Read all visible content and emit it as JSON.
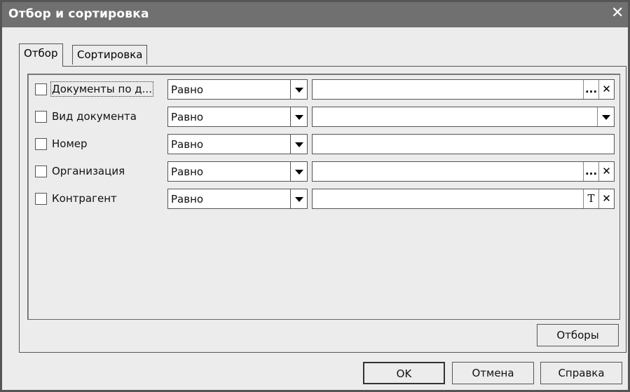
{
  "window": {
    "title": "Отбор и сортировка",
    "close_label": "✕"
  },
  "tabs": [
    {
      "label": "Отбор",
      "active": true
    },
    {
      "label": "Сортировка",
      "active": false
    }
  ],
  "filters": [
    {
      "label": "Документы по д...",
      "condition": "Равно",
      "value": "",
      "buttons": [
        "...",
        "✕"
      ]
    },
    {
      "label": "Вид документа",
      "condition": "Равно",
      "value": "",
      "buttons": [
        "▼"
      ]
    },
    {
      "label": "Номер",
      "condition": "Равно",
      "value": "",
      "buttons": []
    },
    {
      "label": "Организация",
      "condition": "Равно",
      "value": "",
      "buttons": [
        "...",
        "✕"
      ]
    },
    {
      "label": "Контрагент",
      "condition": "Равно",
      "value": "",
      "buttons": [
        "T",
        "✕"
      ]
    }
  ],
  "panel_buttons": {
    "filters_label": "Отборы"
  },
  "footer": {
    "ok_label": "OK",
    "cancel_label": "Отмена",
    "help_label": "Справка"
  }
}
